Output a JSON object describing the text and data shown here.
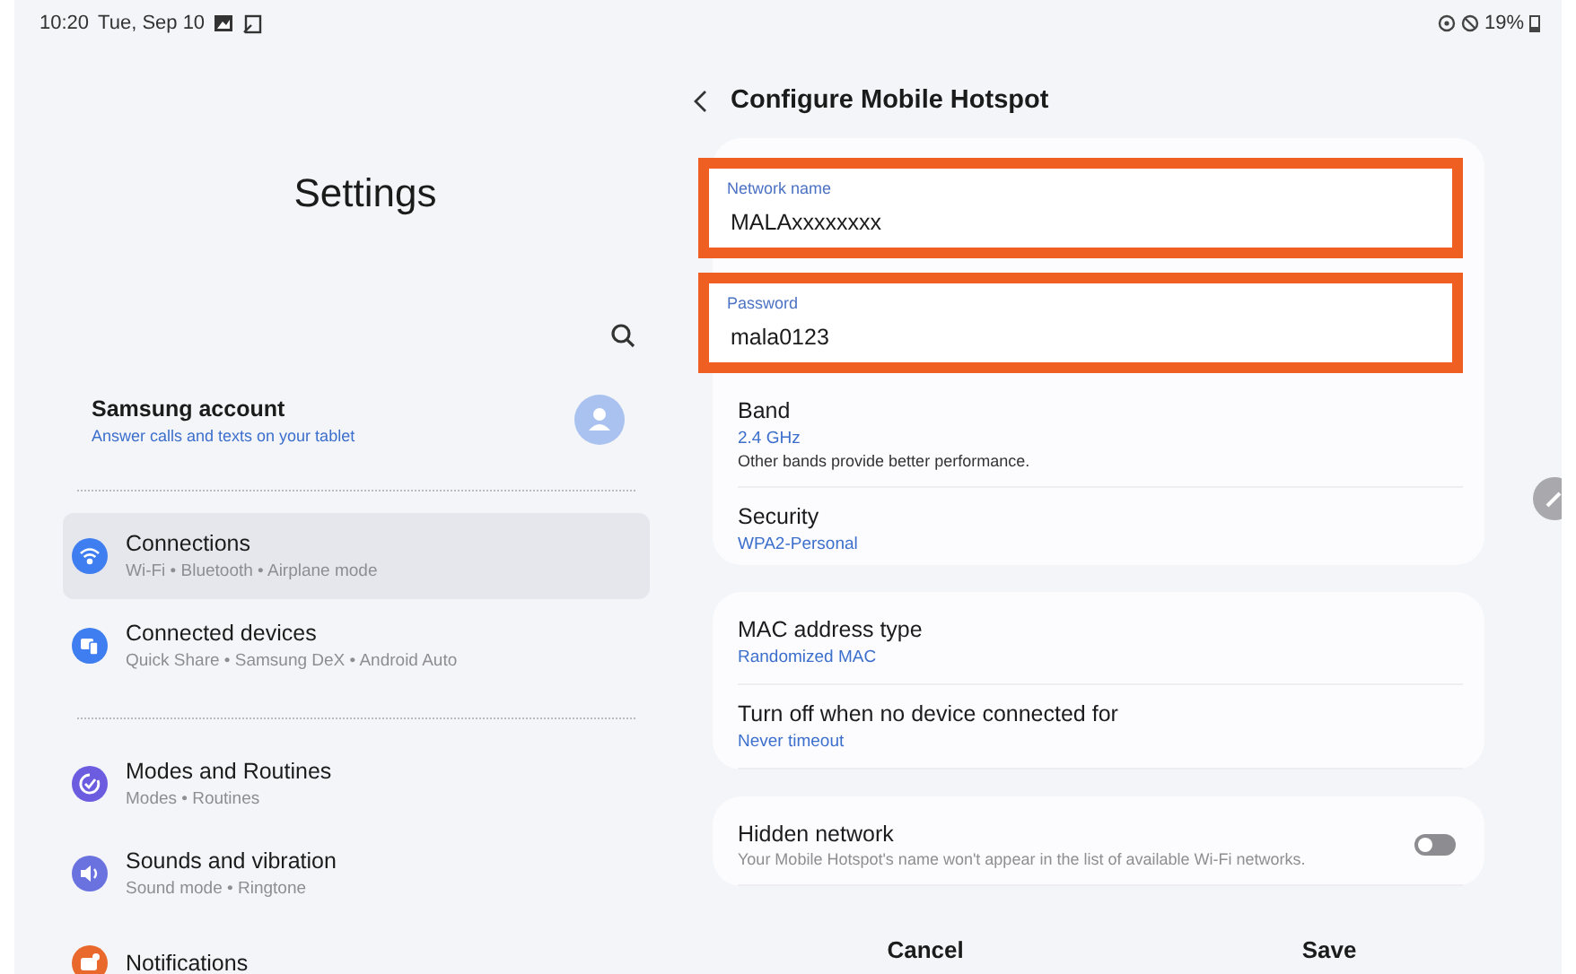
{
  "status_bar": {
    "time": "10:20",
    "date": "Tue, Sep 10",
    "battery": "19%"
  },
  "settings": {
    "title": "Settings",
    "account": {
      "name": "Samsung account",
      "subtitle": "Answer calls and texts on your tablet"
    },
    "groups": [
      [
        {
          "title": "Connections",
          "subtitle": "Wi-Fi • Bluetooth • Airplane mode",
          "kind": "wifi",
          "color": "#3e7ef0",
          "selected": true
        },
        {
          "title": "Connected devices",
          "subtitle": "Quick Share • Samsung DeX • Android Auto",
          "kind": "devices",
          "color": "#3e7ef0",
          "selected": false
        }
      ],
      [
        {
          "title": "Modes and Routines",
          "subtitle": "Modes • Routines",
          "kind": "routines",
          "color": "#6b5ce0",
          "selected": false
        },
        {
          "title": "Sounds and vibration",
          "subtitle": "Sound mode • Ringtone",
          "kind": "sound",
          "color": "#6a72e0",
          "selected": false
        },
        {
          "title": "Notifications",
          "kind": "notifications",
          "color": "#e9692c",
          "selected": false
        }
      ]
    ]
  },
  "hotspot": {
    "title": "Configure Mobile Hotspot",
    "fields": [
      {
        "label": "Network name",
        "value": "MALAxxxxxxxx",
        "highlighted": true
      },
      {
        "label": "Password",
        "value": "mala0123",
        "highlighted": true
      }
    ],
    "cards": [
      [
        {
          "kind": "value",
          "title": "Band",
          "value": "2.4 GHz",
          "note": "Other bands provide better performance."
        },
        {
          "kind": "value",
          "title": "Security",
          "value": "WPA2-Personal"
        }
      ],
      [
        {
          "kind": "value",
          "title": "MAC address type",
          "value": "Randomized MAC"
        },
        {
          "kind": "value",
          "title": "Turn off when no device connected for",
          "value": "Never timeout"
        }
      ],
      [
        {
          "kind": "toggle",
          "title": "Hidden network",
          "note": "Your Mobile Hotspot's name won't appear in the list of available Wi-Fi networks.",
          "on": false
        }
      ]
    ],
    "buttons": [
      "Cancel",
      "Save"
    ]
  }
}
